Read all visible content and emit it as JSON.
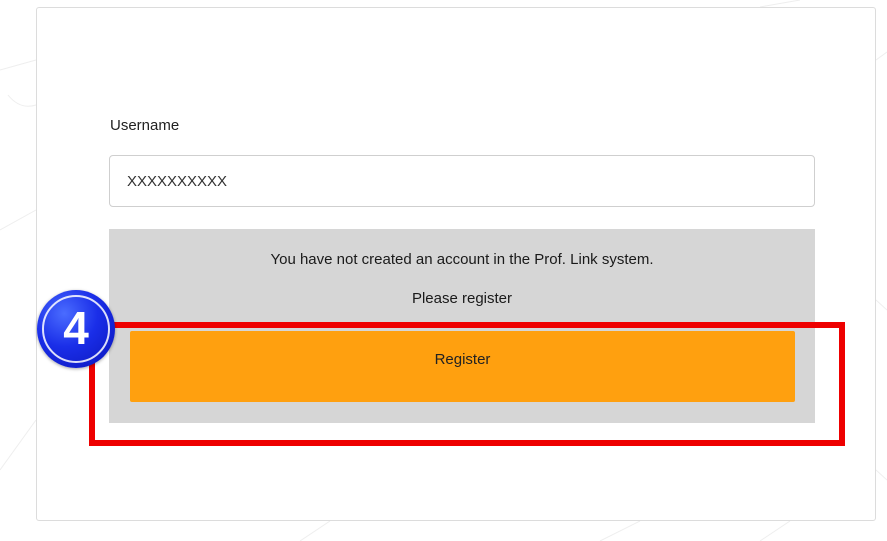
{
  "form": {
    "username_label": "Username",
    "username_value": "XXXXXXXXXX"
  },
  "notice": {
    "line1": "You have not created an account in the Prof. Link system.",
    "line2": "Please register"
  },
  "register_button": {
    "label": "Register"
  },
  "annotation": {
    "step_number": "4",
    "highlight_color": "#ee0000",
    "badge_color": "#1a2ee8"
  },
  "colors": {
    "button": "#ffa00f",
    "notice_background": "#d6d6d6"
  }
}
